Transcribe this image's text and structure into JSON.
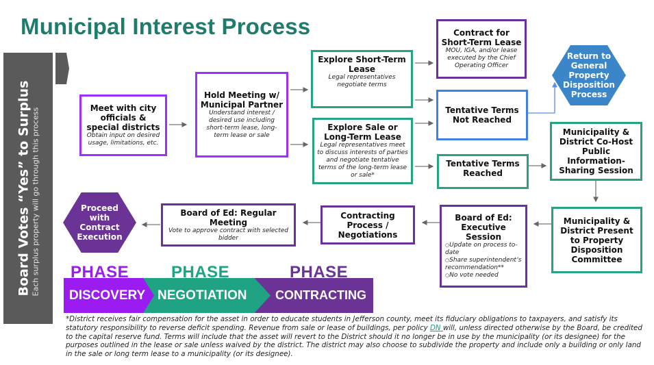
{
  "title": "Municipal Interest Process",
  "sidebar": {
    "main": "Board Votes “Yes” to Surplus",
    "sub": "Each surplus property will go through this process"
  },
  "colors": {
    "title": "#1d7c6c",
    "discovery": "#9b1cf0",
    "negotiation": "#1fa383",
    "contracting": "#6b3395",
    "return_hex": "#3a86c8",
    "sidebar": "#5a5a5a"
  },
  "nodes": {
    "meet_city": {
      "heading": "Meet with city officials & special districts",
      "desc": "Obtain input on desired usage, limitations, etc."
    },
    "hold_meeting": {
      "heading": "Hold Meeting w/ Municipal Partner",
      "desc": "Understand interest / desired use including short-term lease, long-term lease or sale"
    },
    "explore_short": {
      "heading": "Explore Short-Term Lease",
      "desc": "Legal representatives negotiate terms"
    },
    "explore_sale": {
      "heading": "Explore Sale or Long-Term Lease",
      "desc": "Legal representatives meet to discuss interests of parties and negotiate tentative terms of the long-term lease or sale*"
    },
    "contract_short": {
      "heading": "Contract for Short-Term Lease",
      "desc": "MOU, IGA, and/or lease executed by the Chief Operating Officer"
    },
    "not_reached": {
      "heading": "Tentative Terms Not Reached"
    },
    "reached": {
      "heading": "Tentative Terms Reached"
    },
    "return_general": {
      "heading": "Return to General Property Disposition Process"
    },
    "co_host": {
      "heading": "Municipality & District Co-Host Public Information-Sharing Session"
    },
    "present_committee": {
      "heading": "Municipality & District Present to Property Disposition Committee"
    },
    "exec_session": {
      "heading": "Board of Ed: Executive Session",
      "bullets": [
        "Update on process to-date",
        "Share superintendent’s recommendation**",
        "No vote needed"
      ]
    },
    "contracting_process": {
      "heading": "Contracting Process / Negotiations"
    },
    "regular_meeting": {
      "heading": "Board of Ed: Regular Meeting",
      "desc": "Vote to approve contract with selected bidder"
    },
    "proceed": {
      "heading": "Proceed with Contract Execution"
    }
  },
  "phases": [
    {
      "label": "PHASE",
      "name": "DISCOVERY"
    },
    {
      "label": "PHASE",
      "name": "NEGOTIATION"
    },
    {
      "label": "PHASE",
      "name": "CONTRACTING"
    }
  ],
  "footnote": {
    "before_link": "*District receives fair compensation for the asset in order to educate students in Jefferson county, meet its fiduciary obligations to taxpayers, and satisfy its statutory responsibility to reverse deficit spending. Revenue from sale or lease of buildings, per policy ",
    "link": "DN ",
    "after_link": "will, unless directed otherwise by the Board, be credited to the capital reserve fund. Terms will include that the asset will revert to the District should it no longer be in use by the municipality (or its designee) for the purposes outlined in the lease or sale unless waived by the district. The district may also choose to subdivide the property and include only a building or only land in the sale or long term lease to a municipality (or its designee)."
  }
}
